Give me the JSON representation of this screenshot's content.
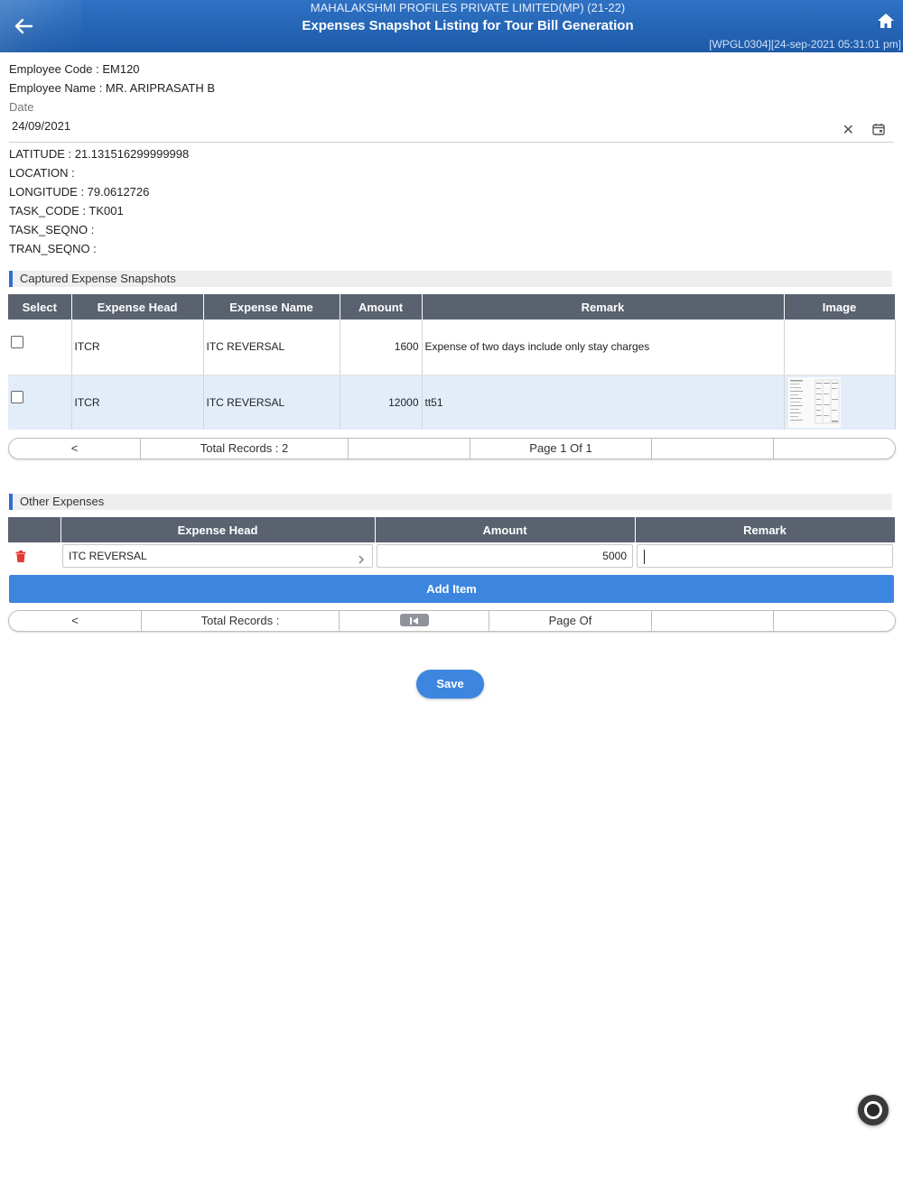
{
  "header": {
    "company": "MAHALAKSHMI PROFILES PRIVATE LIMITED(MP) (21-22)",
    "title": "Expenses Snapshot Listing for Tour Bill Generation",
    "meta": "[WPGL0304][24-sep-2021 05:31:01 pm]",
    "back_icon": "back-arrow-icon",
    "home_icon": "home-icon"
  },
  "employee": {
    "code_label": "Employee Code : EM120",
    "name_label": "Employee Name : MR. ARIPRASATH B"
  },
  "date": {
    "label": "Date",
    "value": "24/09/2021",
    "clear_glyph": "✕"
  },
  "details": [
    "LATITUDE : 21.131516299999998",
    "LOCATION :",
    "LONGITUDE : 79.0612726",
    "TASK_CODE : TK001",
    "TASK_SEQNO :",
    "TRAN_SEQNO :"
  ],
  "snapshots": {
    "section_title": "Captured Expense Snapshots",
    "columns": [
      "Select",
      "Expense Head",
      "Expense Name",
      "Amount",
      "Remark",
      "Image"
    ],
    "rows": [
      {
        "expense_head": "ITCR",
        "expense_name": "ITC REVERSAL",
        "amount": "1600",
        "remark": "Expense of two days include only stay charges",
        "has_image": false
      },
      {
        "expense_head": "ITCR",
        "expense_name": "ITC REVERSAL",
        "amount": "12000",
        "remark": "tt51",
        "has_image": true
      }
    ],
    "pager": {
      "prev_glyph": "<",
      "total_records": "Total Records : 2",
      "page": "Page 1 Of 1"
    }
  },
  "other_expenses": {
    "section_title": "Other Expenses",
    "columns": [
      "Expense Head",
      "Amount",
      "Remark"
    ],
    "row": {
      "expense_head": "ITC REVERSAL",
      "amount": "5000",
      "remark": ""
    },
    "add_item_label": "Add Item",
    "pager": {
      "prev_glyph": "<",
      "total_records": "Total Records :",
      "page": "Page Of"
    }
  },
  "save_label": "Save",
  "colors": {
    "header": "#1d5aa8",
    "accent": "#3d86e0",
    "table_header": "#5a6270",
    "selected_row": "#e3edfa",
    "delete_icon": "#e53935"
  }
}
